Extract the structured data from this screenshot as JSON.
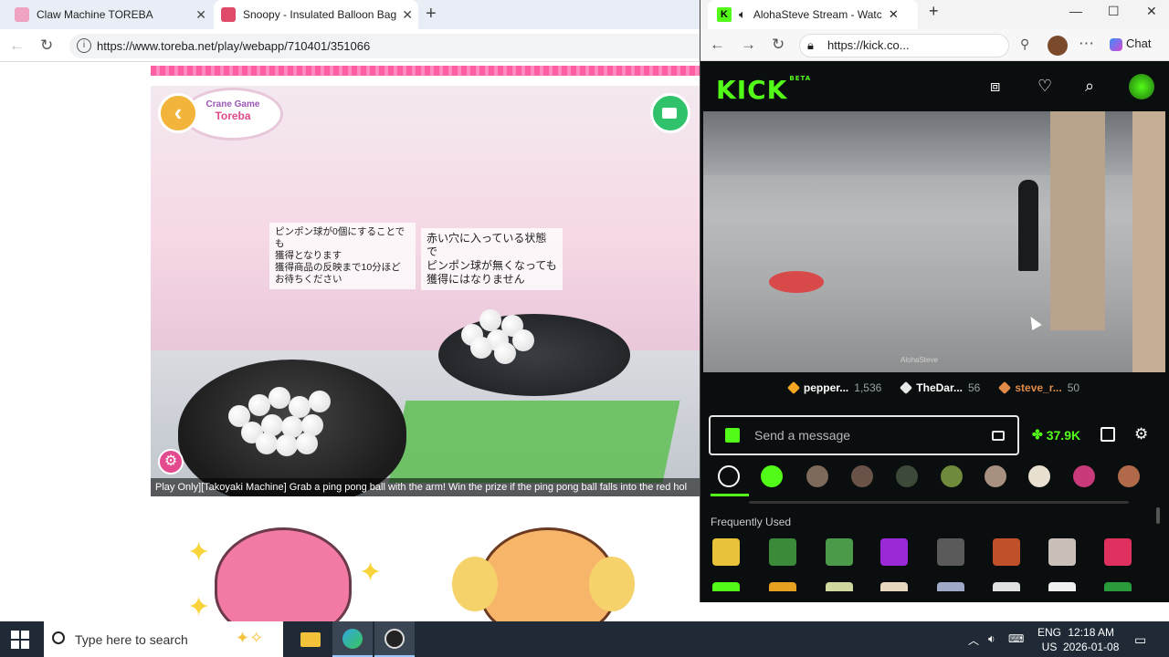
{
  "left_browser": {
    "tabs": [
      {
        "title": "Claw Machine TOREBA",
        "active": false
      },
      {
        "title": "Snoopy - Insulated Balloon Bag S",
        "active": true
      }
    ],
    "url": "https://www.toreba.net/play/webapp/710401/351066",
    "game": {
      "logo_top": "Crane Game",
      "logo_main": "Toreba",
      "sign_left": "ピンポン球が0個にすることでも\n獲得となります\n獲得商品の反映まで10分ほど\nお待ちください",
      "sign_right": "赤い穴に入っている状態で\nピンポン球が無くなっても\n獲得にはなりません",
      "caption": "Play Only][Takoyaki Machine] Grab a ping pong ball with the arm! Win the prize if the ping pong ball falls into the red hol"
    }
  },
  "right_browser": {
    "tab_title": "AlohaSteve Stream - Watch L",
    "url": "https://kick.co...",
    "chat_button": "Chat",
    "logo": "KICK",
    "logo_sup": "BETA",
    "video_watermark": "AlohaSteve",
    "leaderboard": [
      {
        "name": "pepper...",
        "count": "1,536",
        "color": "#f5a623"
      },
      {
        "name": "TheDar...",
        "count": "56",
        "color": "#e8e8e8"
      },
      {
        "name": "steve_r...",
        "count": "50",
        "color": "#e08a4a"
      }
    ],
    "chat": {
      "placeholder": "Send a message",
      "kicks": "37.9K",
      "frequently_used": "Frequently Used"
    }
  },
  "taskbar": {
    "search_placeholder": "Type here to search",
    "lang_1": "ENG",
    "lang_2": "US",
    "time": "12:18 AM",
    "date": "2026-01-08"
  }
}
